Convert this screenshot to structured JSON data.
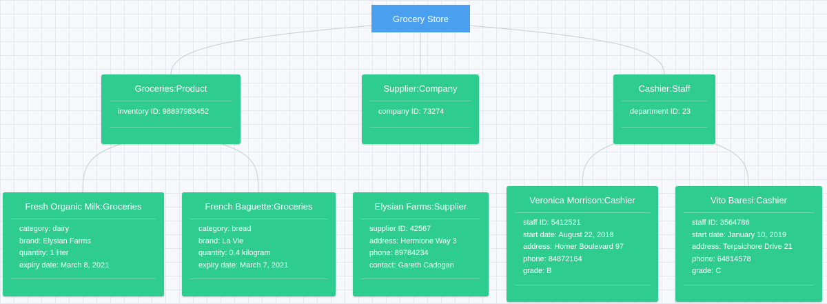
{
  "root": {
    "label": "Grocery Store"
  },
  "level1": [
    {
      "title": "Groceries:Product",
      "attrs": [
        "inventory ID: 98897983452"
      ]
    },
    {
      "title": "Supplier:Company",
      "attrs": [
        "company ID: 73274"
      ]
    },
    {
      "title": "Cashier:Staff",
      "attrs": [
        "department ID: 23"
      ]
    }
  ],
  "level2": [
    {
      "title": "Fresh Organic Milk:Groceries",
      "attrs": [
        "category: dairy",
        "brand: Elysian Farms",
        "quantity: 1 liter",
        "expiry date: March 8, 2021"
      ]
    },
    {
      "title": "French Baguette:Groceries",
      "attrs": [
        "category: bread",
        "brand: La Vie",
        "quantity: 0.4 kilogram",
        "expiry date: March 7, 2021"
      ]
    },
    {
      "title": "Elysian Farms:Supplier",
      "attrs": [
        "supplier ID: 42567",
        "address: Hermione Way 3",
        "phone: 89784234",
        "contact: Gareth Cadogan"
      ]
    },
    {
      "title": "Veronica Morrison:Cashier",
      "attrs": [
        "staff ID: 5412521",
        "start date: August 22, 2018",
        "address: Homer Boulevard 97",
        "phone: 84872164",
        "grade: B"
      ]
    },
    {
      "title": "Vito Baresi:Cashier",
      "attrs": [
        "staff ID: 3564786",
        "start date: January 10, 2019",
        "address: Terpsichore Drive 21",
        "phone: 64814578",
        "grade: C"
      ]
    }
  ],
  "colors": {
    "root": "#4a9fee",
    "node": "#2ecc8f",
    "connector": "#c9ccd1"
  }
}
